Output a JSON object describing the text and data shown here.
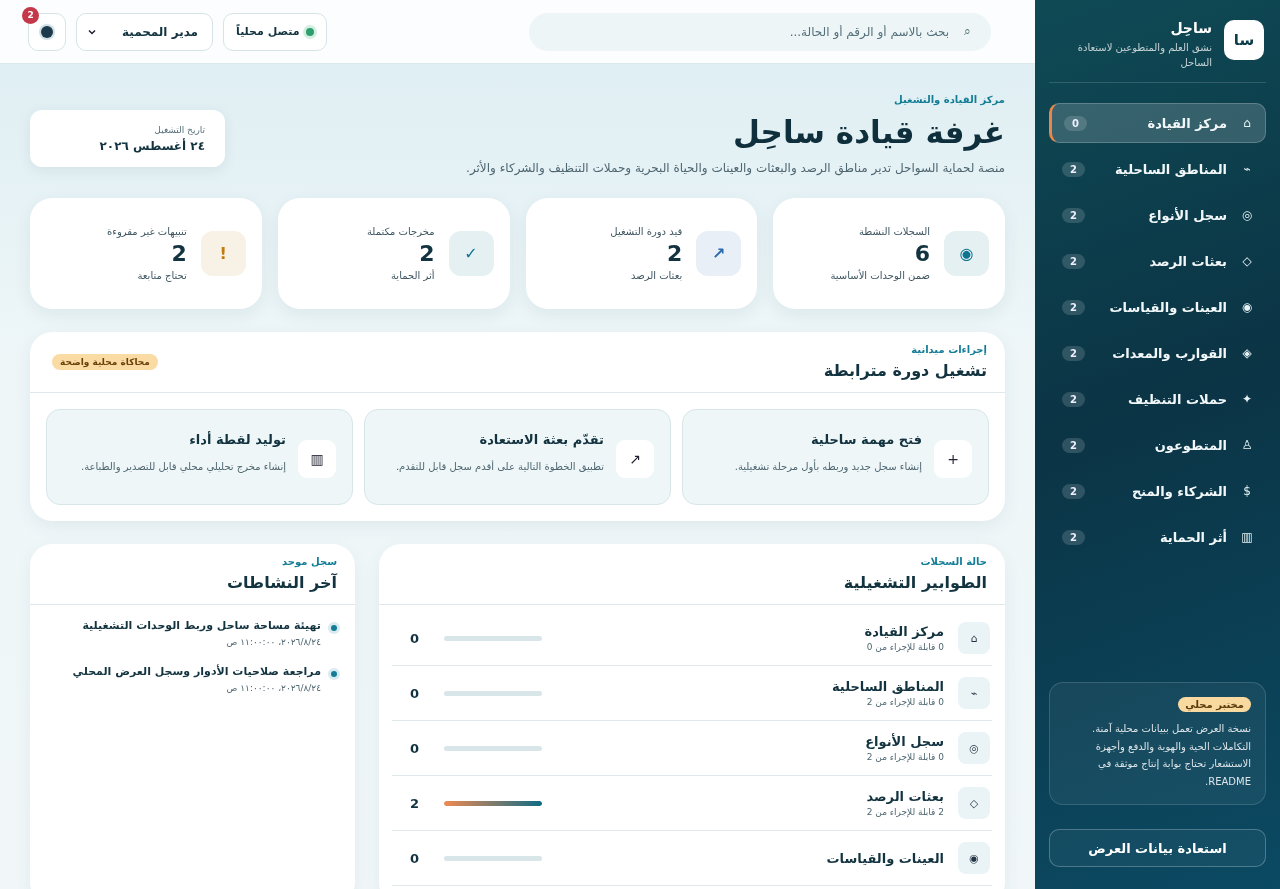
{
  "sidebar": {
    "logo": "سا",
    "brand": "ساحِل",
    "tagline": "نشق العلم والمتطوعين لاستعادة الساحل",
    "items": [
      {
        "icon": "⌂",
        "label": "مركز القيادة",
        "count": "0",
        "selected": true
      },
      {
        "icon": "⌁",
        "label": "المناطق الساحلية",
        "count": "2",
        "selected": false
      },
      {
        "icon": "◎",
        "label": "سجل الأنواع",
        "count": "2",
        "selected": false
      },
      {
        "icon": "◇",
        "label": "بعثات الرصد",
        "count": "2",
        "selected": false
      },
      {
        "icon": "◉",
        "label": "العينات والقياسات",
        "count": "2",
        "selected": false
      },
      {
        "icon": "◈",
        "label": "القوارب والمعدات",
        "count": "2",
        "selected": false
      },
      {
        "icon": "✦",
        "label": "حملات التنظيف",
        "count": "2",
        "selected": false
      },
      {
        "icon": "♙",
        "label": "المتطوعون",
        "count": "2",
        "selected": false
      },
      {
        "icon": "$",
        "label": "الشركاء والمنح",
        "count": "2",
        "selected": false
      },
      {
        "icon": "▥",
        "label": "أثر الحماية",
        "count": "2",
        "selected": false
      }
    ],
    "note": {
      "badge": "مختبر محلي",
      "text": "نسخة العرض تعمل ببيانات محلية آمنة. التكاملات الحية والهوية والدفع وأجهزة الاستشعار تحتاج بوابة إنتاج موثقة في README."
    },
    "restore_button": "استعادة بيانات العرض"
  },
  "topbar": {
    "search": {
      "icon": "⌕",
      "placeholder": "بحث بالاسم أو الرقم أو الحالة..."
    },
    "status": {
      "label": "متصل محلياً",
      "on": true
    },
    "role_select": "مدير المحمية",
    "notifications": "2"
  },
  "header": {
    "eyebrow": "مركز القيادة والتشغيل",
    "title": "غرفة قيادة ساحِل",
    "description": "منصة لحماية السواحل تدير مناطق الرصد والبعثات والعينات والحياة البحرية وحملات التنظيف والشركاء والأثر.",
    "date_label": "تاريخ التشغيل",
    "date": "٢٤ أغسطس ٢٠٢٦"
  },
  "stats": [
    {
      "icon": "◉",
      "color": "#0e7490",
      "label": "السجلات النشطة",
      "value": "6",
      "note": "ضمن الوحدات الأساسية"
    },
    {
      "icon": "↗",
      "color": "#2b6cb0",
      "label": "قيد دورة التشغيل",
      "value": "2",
      "note": "بعثات الرصد"
    },
    {
      "icon": "✓",
      "color": "#0e7490",
      "label": "مخرجات مكتملة",
      "value": "2",
      "note": "أثر الحماية"
    },
    {
      "icon": "!",
      "color": "#c27c0e",
      "label": "تنبيهات غير مقروءة",
      "value": "2",
      "note": "تحتاج متابعة"
    }
  ],
  "actions": {
    "eyebrow": "إجراءات ميدانية",
    "title": "تشغيل دورة مترابطة",
    "badge": "محاكاة محلية واضحة",
    "items": [
      {
        "icon": "+",
        "title": "فتح مهمة ساحلية",
        "text": "إنشاء سجل جديد وربطه بأول مرحلة تشغيلية."
      },
      {
        "icon": "↗",
        "title": "تقدّم بعثة الاستعادة",
        "text": "تطبيق الخطوة التالية على أقدم سجل قابل للتقدم."
      },
      {
        "icon": "▥",
        "title": "توليد لقطة أداء",
        "text": "إنشاء مخرج تحليلي محلي قابل للتصدير والطباعة."
      }
    ]
  },
  "queues": {
    "eyebrow": "حالة السجلات",
    "title": "الطوابير التشغيلية",
    "rows": [
      {
        "icon": "⌂",
        "title": "مركز القيادة",
        "subtitle": "0 قابلة للإجراء من 0",
        "value": "0",
        "level": 0
      },
      {
        "icon": "⌁",
        "title": "المناطق الساحلية",
        "subtitle": "0 قابلة للإجراء من 2",
        "value": "0",
        "level": 0
      },
      {
        "icon": "◎",
        "title": "سجل الأنواع",
        "subtitle": "0 قابلة للإجراء من 2",
        "value": "0",
        "level": 0
      },
      {
        "icon": "◇",
        "title": "بعثات الرصد",
        "subtitle": "2 قابلة للإجراء من 2",
        "value": "2",
        "level": 1
      },
      {
        "icon": "◉",
        "title": "العينات والقياسات",
        "value": "0",
        "level": 0
      }
    ]
  },
  "activity": {
    "eyebrow": "سجل موحد",
    "title": "آخر النشاطات",
    "items": [
      {
        "title": "تهيئة مساحة ساحل وربط الوحدات التشغيلية",
        "time": "٢٠٢٦/٨/٢٤، ١١:٠٠:٠٠ ص"
      },
      {
        "title": "مراجعة صلاحيات الأدوار وسجل العرض المحلي",
        "time": "٢٠٢٦/٨/٢٤، ١١:٠٠:٠٠ ص"
      }
    ]
  }
}
